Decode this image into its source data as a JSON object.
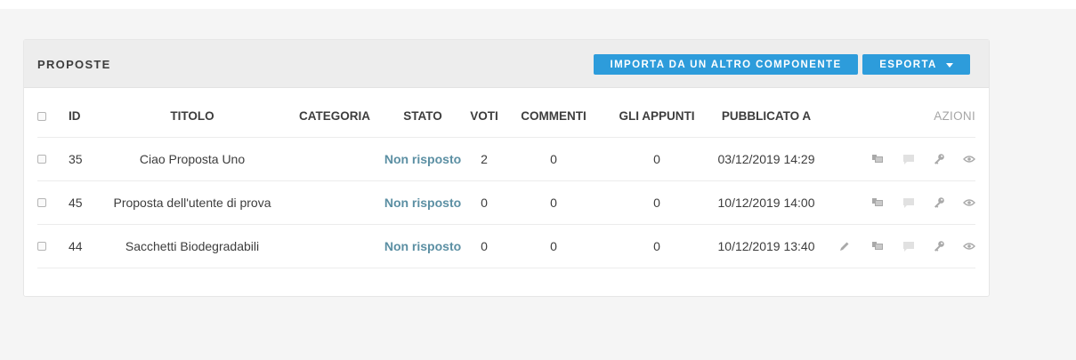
{
  "header": {
    "title": "PROPOSTE",
    "import_label": "IMPORTA DA UN ALTRO COMPONENTE",
    "export_label": "ESPORTA"
  },
  "table": {
    "columns": {
      "id": "ID",
      "title": "TITOLO",
      "category": "CATEGORIA",
      "state": "STATO",
      "votes": "VOTI",
      "comments": "COMMENTI",
      "notes": "GLI APPUNTI",
      "published": "PUBBLICATO A",
      "actions": "AZIONI"
    },
    "rows": [
      {
        "id": "35",
        "title": "Ciao Proposta Uno",
        "category": "",
        "state": "Non risposto",
        "votes": "2",
        "comments": "0",
        "notes": "0",
        "published": "03/12/2019 14:29",
        "actions": [
          "copy-icon",
          "comment-icon",
          "key-icon",
          "eye-icon"
        ]
      },
      {
        "id": "45",
        "title": "Proposta dell'utente di prova",
        "category": "",
        "state": "Non risposto",
        "votes": "0",
        "comments": "0",
        "notes": "0",
        "published": "10/12/2019 14:00",
        "actions": [
          "copy-icon",
          "comment-icon",
          "key-icon",
          "eye-icon"
        ]
      },
      {
        "id": "44",
        "title": "Sacchetti Biodegradabili",
        "category": "",
        "state": "Non risposto",
        "votes": "0",
        "comments": "0",
        "notes": "0",
        "published": "10/12/2019 13:40",
        "actions": [
          "pencil-icon",
          "copy-icon",
          "comment-icon",
          "key-icon",
          "eye-icon"
        ]
      }
    ]
  },
  "colors": {
    "accent": "#2d9cdb",
    "state_text": "#5b8fa3",
    "icon": "#a9a9a9",
    "icon_disabled": "#e1e1e1"
  }
}
